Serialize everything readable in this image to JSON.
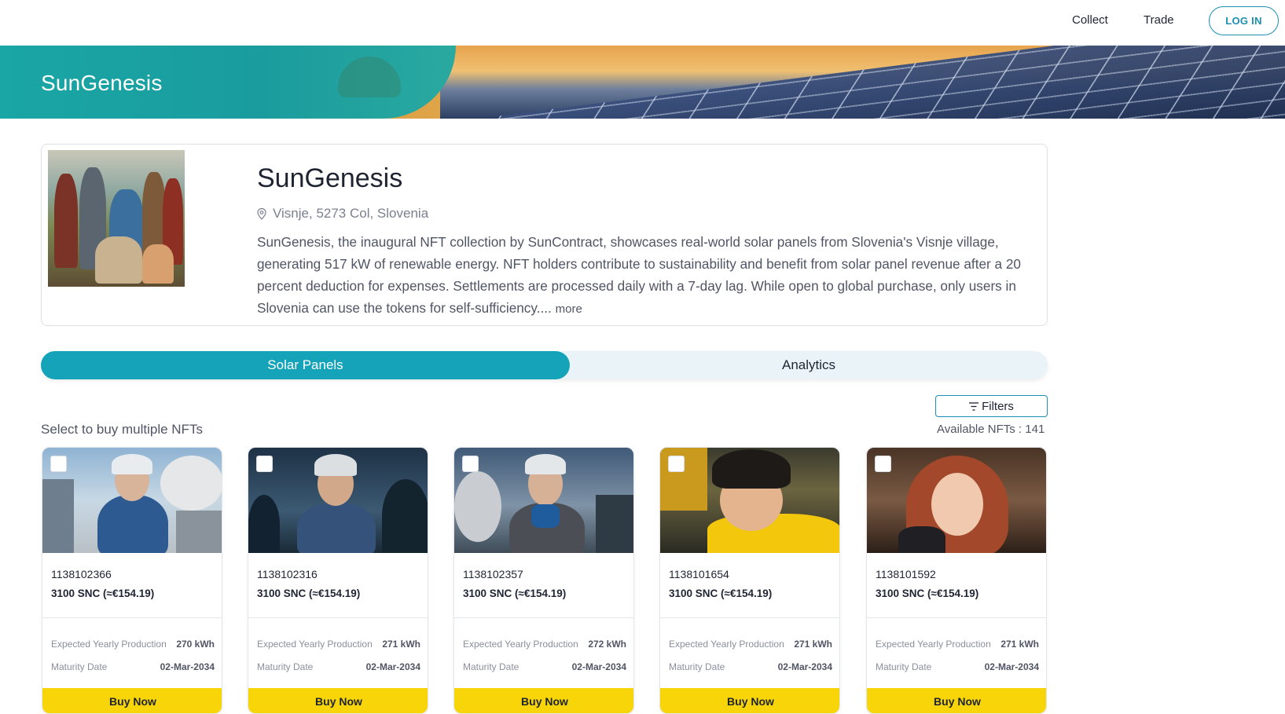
{
  "nav": {
    "collect": "Collect",
    "trade": "Trade",
    "login": "LOG IN"
  },
  "banner": {
    "title": "SunGenesis"
  },
  "collection": {
    "title": "SunGenesis",
    "location": "Visnje, 5273 Col, Slovenia",
    "description": "SunGenesis, the inaugural NFT collection by SunContract, showcases real-world solar panels from Slovenia's Visnje village, generating 517 kW of renewable energy. NFT holders contribute to sustainability and benefit from solar panel revenue after a 20 percent deduction for expenses. Settlements are processed daily with a 7-day lag. While open to global purchase, only users in Slovenia can use the tokens for self-sufficiency....",
    "more": "more"
  },
  "tabs": {
    "solar_panels": "Solar Panels",
    "analytics": "Analytics"
  },
  "list": {
    "filters": "Filters",
    "select_label": "Select to buy multiple NFTs",
    "available": "Available NFTs : 141"
  },
  "labels": {
    "production": "Expected Yearly Production",
    "maturity": "Maturity Date",
    "buy": "Buy Now"
  },
  "nfts": [
    {
      "id": "1138102366",
      "price": "3100 SNC (≈€154.19)",
      "production": "270 kWh",
      "maturity": "02-Mar-2034"
    },
    {
      "id": "1138102316",
      "price": "3100 SNC (≈€154.19)",
      "production": "271 kWh",
      "maturity": "02-Mar-2034"
    },
    {
      "id": "1138102357",
      "price": "3100 SNC (≈€154.19)",
      "production": "272 kWh",
      "maturity": "02-Mar-2034"
    },
    {
      "id": "1138101654",
      "price": "3100 SNC (≈€154.19)",
      "production": "271 kWh",
      "maturity": "02-Mar-2034"
    },
    {
      "id": "1138101592",
      "price": "3100 SNC (≈€154.19)",
      "production": "271 kWh",
      "maturity": "02-Mar-2034"
    }
  ]
}
